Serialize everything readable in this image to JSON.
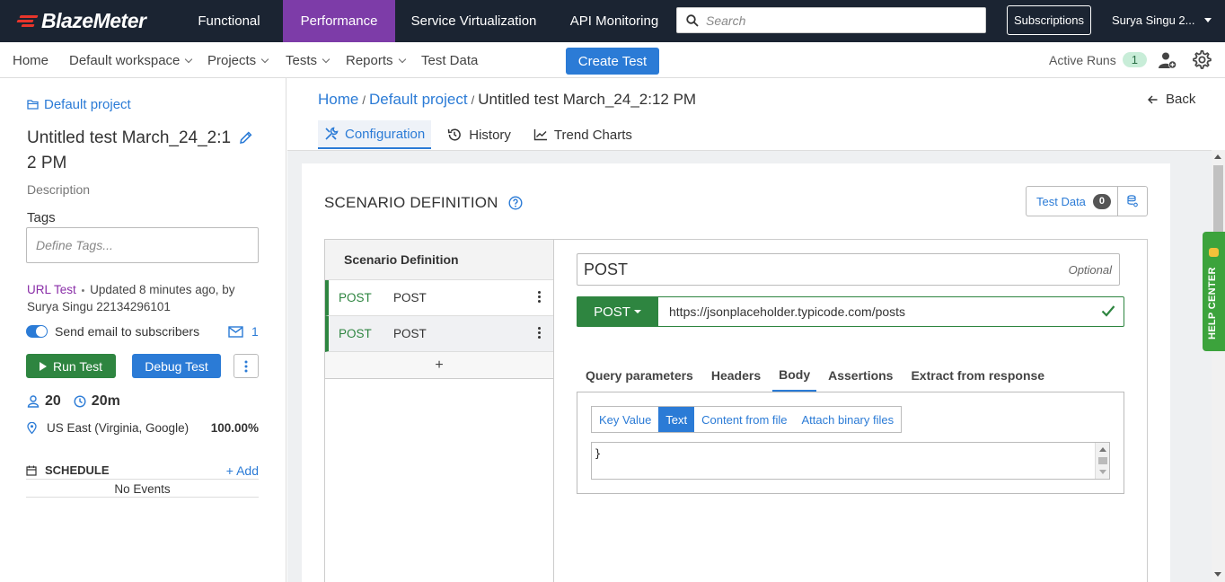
{
  "brand": {
    "name": "BlazeMeter"
  },
  "topnav": {
    "items": [
      "Functional",
      "Performance",
      "Service Virtualization",
      "API Monitoring"
    ],
    "active": "Performance",
    "search_placeholder": "Search",
    "subscriptions": "Subscriptions",
    "user": "Surya Singu 2..."
  },
  "subnav": {
    "home": "Home",
    "workspace": "Default workspace",
    "projects": "Projects",
    "tests": "Tests",
    "reports": "Reports",
    "test_data": "Test Data",
    "create_test": "Create Test",
    "active_runs_label": "Active Runs",
    "active_runs_count": "1"
  },
  "left": {
    "project": "Default project",
    "test_title": "Untitled test March_24_2:12 PM",
    "description": "Description",
    "tags_label": "Tags",
    "tags_placeholder": "Define Tags...",
    "test_type": "URL Test",
    "bullet": "•",
    "updated": "Updated 8 minutes ago, by Surya Singu 22134296101",
    "send_email": "Send email to subscribers",
    "subscribers_count": "1",
    "run_test": "Run Test",
    "debug_test": "Debug Test",
    "users": "20",
    "duration": "20m",
    "location": "US East (Virginia, Google)",
    "location_pct": "100.00%",
    "schedule_label": "SCHEDULE",
    "schedule_add": "Add",
    "no_events": "No Events"
  },
  "breadcrumb": {
    "home": "Home",
    "project": "Default project",
    "current": "Untitled test March_24_2:12 PM",
    "separator": "/"
  },
  "back": "Back",
  "tabs": [
    "Configuration",
    "History",
    "Trend Charts"
  ],
  "scenario": {
    "title": "SCENARIO DEFINITION",
    "test_data_label": "Test Data",
    "test_data_count": "0",
    "list_header": "Scenario Definition",
    "requests": [
      {
        "method": "POST",
        "name": "POST"
      },
      {
        "method": "POST",
        "name": "POST"
      }
    ],
    "add_symbol": "+",
    "label_value": "POST",
    "label_optional": "Optional",
    "method": "POST",
    "url": "https://jsonplaceholder.typicode.com/posts",
    "request_tabs": [
      "Query parameters",
      "Headers",
      "Body",
      "Assertions",
      "Extract from response"
    ],
    "active_request_tab": "Body",
    "body_tabs": [
      "Key Value",
      "Text",
      "Content from file",
      "Attach binary files"
    ],
    "active_body_tab": "Text",
    "body_text": "}"
  },
  "help_center": "HELP CENTER",
  "colors": {
    "topbar": "#1b2432",
    "performance": "#7d3ca8",
    "accent": "#2b7bd6",
    "green": "#2e8540"
  }
}
